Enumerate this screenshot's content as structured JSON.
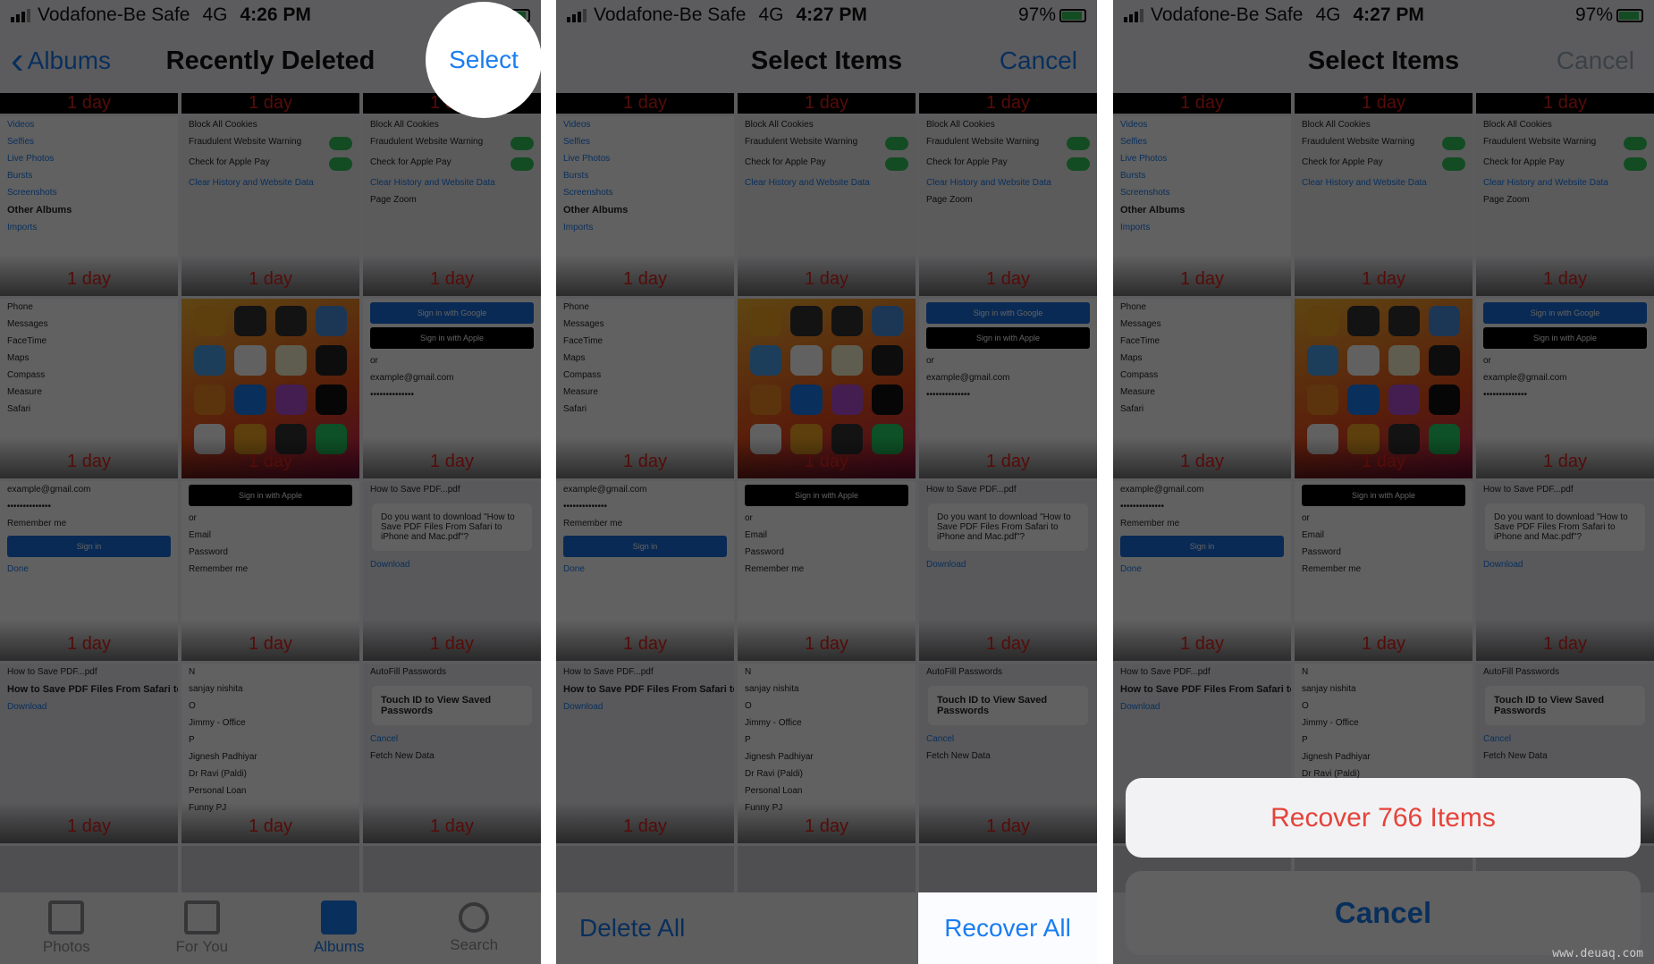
{
  "colors": {
    "accent": "#1a7df1",
    "destructive": "#e5433a",
    "expiry": "#e0201a",
    "toggle": "#34c759"
  },
  "panels": [
    {
      "status": {
        "carrier": "Vodafone-Be Safe",
        "network": "4G",
        "time": "4:26 PM",
        "battery": "97%"
      },
      "nav": {
        "back": "Albums",
        "title": "Recently Deleted",
        "right": "Select"
      },
      "tabs": [
        {
          "label": "Photos",
          "icon": "photos-icon"
        },
        {
          "label": "For You",
          "icon": "for-you-icon"
        },
        {
          "label": "Albums",
          "icon": "albums-icon",
          "active": true
        },
        {
          "label": "Search",
          "icon": "search-icon"
        }
      ]
    },
    {
      "status": {
        "carrier": "Vodafone-Be Safe",
        "network": "4G",
        "time": "4:27 PM",
        "battery": "97%"
      },
      "nav": {
        "title": "Select Items",
        "right": "Cancel"
      },
      "bottom": {
        "delete_all": "Delete All",
        "recover_all": "Recover All"
      }
    },
    {
      "status": {
        "carrier": "Vodafone-Be Safe",
        "network": "4G",
        "time": "4:27 PM",
        "battery": "97%"
      },
      "nav": {
        "title": "Select Items",
        "right": "Cancel"
      },
      "action_sheet": {
        "recover": "Recover 766 Items",
        "cancel": "Cancel"
      }
    }
  ],
  "expiry_label": "1 day",
  "thumbnails": [
    {
      "kind": "list",
      "lines": [
        {
          "t": "Videos",
          "c": "blue"
        },
        {
          "t": "Selfies",
          "c": "blue"
        },
        {
          "t": "Live Photos",
          "c": "blue"
        },
        {
          "t": "Bursts",
          "c": "blue"
        },
        {
          "t": "Screenshots",
          "c": "blue"
        },
        {
          "t": "Other Albums",
          "c": "bold"
        },
        {
          "t": "Imports",
          "c": "blue"
        }
      ]
    },
    {
      "kind": "settings",
      "lines": [
        {
          "t": "Block All Cookies"
        },
        {
          "t": "Fraudulent Website Warning",
          "tog": true
        },
        {
          "t": "Check for Apple Pay",
          "tog": true
        },
        {
          "t": "Clear History and Website Data",
          "c": "blue"
        }
      ]
    },
    {
      "kind": "settings",
      "lines": [
        {
          "t": "Block All Cookies"
        },
        {
          "t": "Fraudulent Website Warning",
          "tog": true
        },
        {
          "t": "Check for Apple Pay",
          "tog": true
        },
        {
          "t": "Clear History and Website Data",
          "c": "blue"
        },
        {
          "t": "Page Zoom"
        }
      ]
    },
    {
      "kind": "list",
      "lines": [
        {
          "t": "Phone"
        },
        {
          "t": "Messages"
        },
        {
          "t": "FaceTime"
        },
        {
          "t": "Maps"
        },
        {
          "t": "Compass"
        },
        {
          "t": "Measure"
        },
        {
          "t": "Safari"
        }
      ]
    },
    {
      "kind": "homescreen",
      "icons": [
        "#f5a623",
        "#333",
        "#333",
        "#4a90e2",
        "#4aa3f0",
        "#fff",
        "#f8f3d0",
        "#222",
        "#f08a24",
        "#1a7df1",
        "#b24fd6",
        "#111",
        "#fff",
        "#f5a623",
        "#333",
        "#25d366"
      ]
    },
    {
      "kind": "form",
      "lines": [
        {
          "btn": "Sign in with Google",
          "bg": "#1a6fe0"
        },
        {
          "btn": "Sign in with Apple",
          "bg": "#000"
        },
        {
          "t": "or"
        },
        {
          "t": "example@gmail.com"
        },
        {
          "t": "••••••••••••••"
        }
      ]
    },
    {
      "kind": "form",
      "lines": [
        {
          "t": "example@gmail.com"
        },
        {
          "t": "••••••••••••••"
        },
        {
          "t": "Remember me"
        },
        {
          "btn": "Sign in",
          "bg": "#1a6fe0"
        },
        {
          "t": "Done",
          "c": "blue"
        }
      ]
    },
    {
      "kind": "form",
      "lines": [
        {
          "btn": "Sign in with Apple",
          "bg": "#000"
        },
        {
          "t": "or"
        },
        {
          "t": "Email"
        },
        {
          "t": "Password"
        },
        {
          "t": "Remember me"
        }
      ]
    },
    {
      "kind": "dialog",
      "lines": [
        {
          "t": "How to Save PDF...pdf"
        },
        {
          "t": "Do you want to download \"How to Save PDF Files From Safari to iPhone and Mac.pdf\"?"
        },
        {
          "t": "Download",
          "c": "blue"
        }
      ]
    },
    {
      "kind": "doc",
      "lines": [
        {
          "t": "How to Save PDF...pdf"
        },
        {
          "t": "How to Save PDF Files From Safari to iPhone and Mac",
          "c": "bold"
        },
        {
          "t": "Download",
          "c": "blue"
        }
      ]
    },
    {
      "kind": "list",
      "lines": [
        {
          "t": "N"
        },
        {
          "t": "sanjay nishita"
        },
        {
          "t": "O"
        },
        {
          "t": "Jimmy - Office"
        },
        {
          "t": "P"
        },
        {
          "t": "Jignesh Padhiyar"
        },
        {
          "t": "Dr Ravi (Paldi)"
        },
        {
          "t": "Personal Loan"
        },
        {
          "t": "Funny PJ"
        }
      ]
    },
    {
      "kind": "dialog",
      "lines": [
        {
          "t": "AutoFill Passwords"
        },
        {
          "t": "Touch ID to View Saved Passwords",
          "c": "bold"
        },
        {
          "t": "Cancel",
          "c": "blue"
        },
        {
          "t": "Fetch New Data"
        }
      ]
    }
  ],
  "watermark": "www.deuaq.com"
}
